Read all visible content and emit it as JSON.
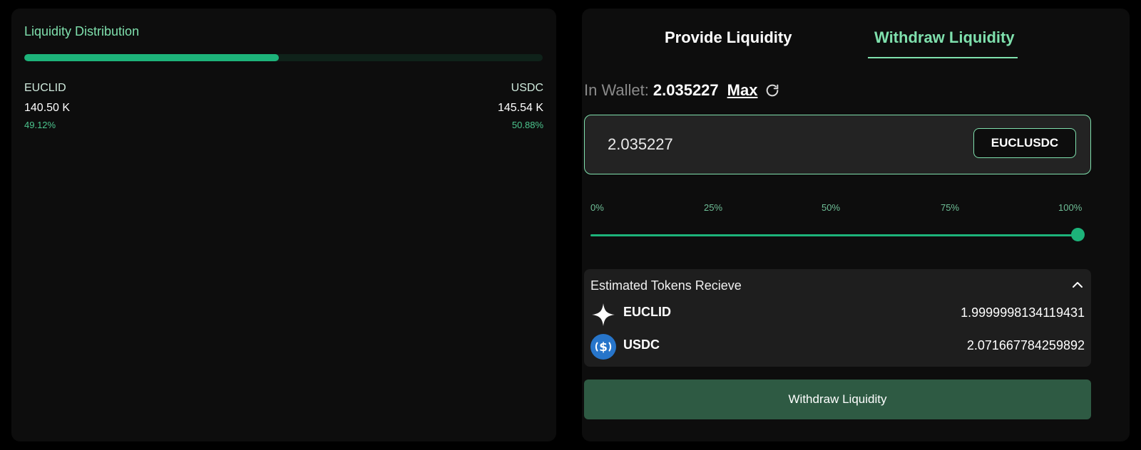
{
  "distribution": {
    "title": "Liquidity Distribution",
    "fill_fraction": 0.4912,
    "left": {
      "token": "EUCLID",
      "amount": "140.50 K",
      "percent": "49.12%"
    },
    "right": {
      "token": "USDC",
      "amount": "145.54 K",
      "percent": "50.88%"
    }
  },
  "tabs": [
    {
      "label": "Provide Liquidity",
      "active": false
    },
    {
      "label": "Withdraw Liquidity",
      "active": true
    }
  ],
  "wallet": {
    "label": "In Wallet:",
    "value": "2.035227",
    "max_label": "Max",
    "refresh_icon": "refresh-icon"
  },
  "amount_input": {
    "value": "2.035227",
    "token_label": "EUCLUSDC"
  },
  "slider": {
    "ticks": [
      "0%",
      "25%",
      "50%",
      "75%",
      "100%"
    ],
    "value_percent": 100
  },
  "estimate": {
    "title": "Estimated Tokens Recieve",
    "collapse_icon": "chevron-up-icon",
    "rows": [
      {
        "token": "EUCLID",
        "icon": "sparkle-icon",
        "value": "1.9999998134119431"
      },
      {
        "token": "USDC",
        "icon": "usdc-icon",
        "value": "2.071667784259892"
      }
    ]
  },
  "action_button": {
    "label": "Withdraw Liquidity"
  },
  "colors": {
    "accent": "#7fe0ad",
    "fill": "#1db37a",
    "panel_bg": "#0d0d0d",
    "button_bg": "#2e5a43",
    "usdc_blue": "#2775ca"
  }
}
